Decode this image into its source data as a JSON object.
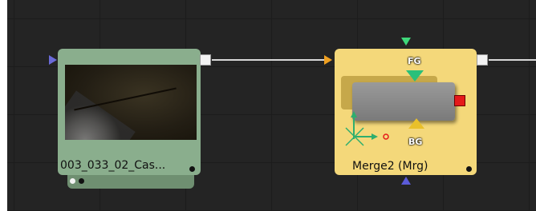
{
  "flow": {
    "loader": {
      "label": "003_033_02_Cas..."
    },
    "merge": {
      "label": "Merge2 (Mrg)",
      "fg_label": "FG",
      "bg_label": "BG"
    }
  },
  "colors": {
    "canvas_bg": "#242424",
    "loader_node": "#8aae8d",
    "merge_node": "#f4d87a",
    "fg_port": "#29c07a",
    "bg_port": "#e9c02a",
    "mask_port": "#e51a1a",
    "input_arrow_loader": "#6a6ad8",
    "input_arrow_merge": "#f0a020"
  },
  "icons": {
    "transform_widget": "axis-crosshair-icon"
  }
}
